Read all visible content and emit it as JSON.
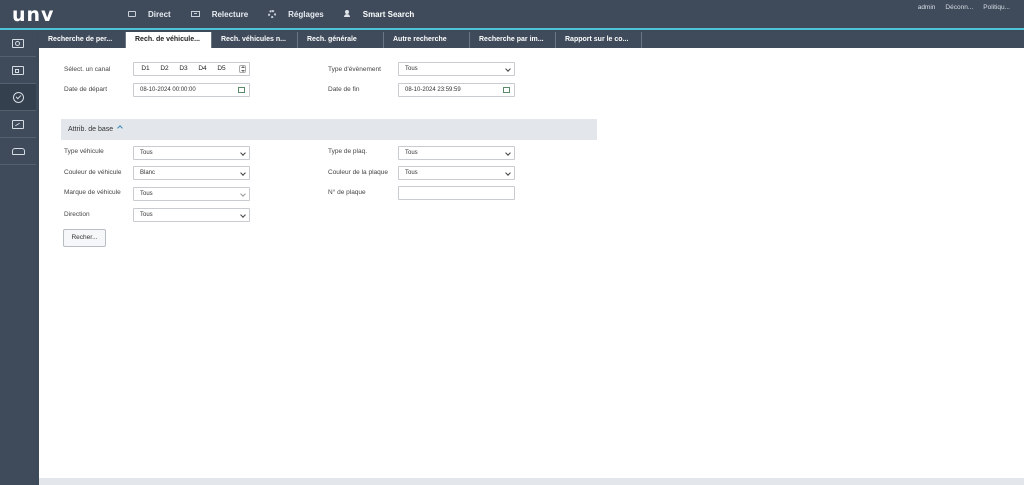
{
  "app": {
    "logo": "unv",
    "nav": [
      {
        "label": "Direct",
        "icon": "monitor-icon"
      },
      {
        "label": "Relecture",
        "icon": "playback-icon"
      },
      {
        "label": "Réglages",
        "icon": "gear-icon"
      },
      {
        "label": "Smart Search",
        "icon": "user-search-icon",
        "active": true
      }
    ],
    "user_links": [
      "admin",
      "Déconn...",
      "Politiqu..."
    ],
    "accent_color": "#4ec3d8"
  },
  "sidebar": {
    "items": [
      {
        "icon": "face-search-icon"
      },
      {
        "icon": "person-card-icon"
      },
      {
        "icon": "vehicle-check-icon",
        "active": true
      },
      {
        "icon": "scene-icon"
      },
      {
        "icon": "car-icon"
      }
    ]
  },
  "tabs": [
    "Recherche de per...",
    "Rech. de véhicule...",
    "Rech. véhicules n...",
    "Rech. générale",
    "Autre recherche",
    "Recherche par im...",
    "Rapport sur le co..."
  ],
  "active_tab": 1,
  "form": {
    "channel_label": "Sélect. un canal",
    "channels": [
      "D1",
      "D2",
      "D3",
      "D4",
      "D5"
    ],
    "event_type_label": "Type d'évènement",
    "event_type_value": "Tous",
    "start_date_label": "Date de départ",
    "start_date_value": "08-10-2024 00:00:00",
    "end_date_label": "Date de fin",
    "end_date_value": "08-10-2024 23:59:59",
    "section_label": "Attrib. de base",
    "vehicle_type_label": "Type véhicule",
    "vehicle_type_value": "Tous",
    "plate_type_label": "Type de plaq.",
    "plate_type_value": "Tous",
    "vehicle_color_label": "Couleur de véhicule",
    "vehicle_color_value": "Blanc",
    "plate_color_label": "Couleur de la plaque",
    "plate_color_value": "Tous",
    "brand_label": "Marque de véhicule",
    "brand_value": "Tous",
    "plate_number_label": "N° de plaque",
    "plate_number_value": "",
    "direction_label": "Direction",
    "direction_value": "Tous",
    "search_button": "Recher..."
  }
}
